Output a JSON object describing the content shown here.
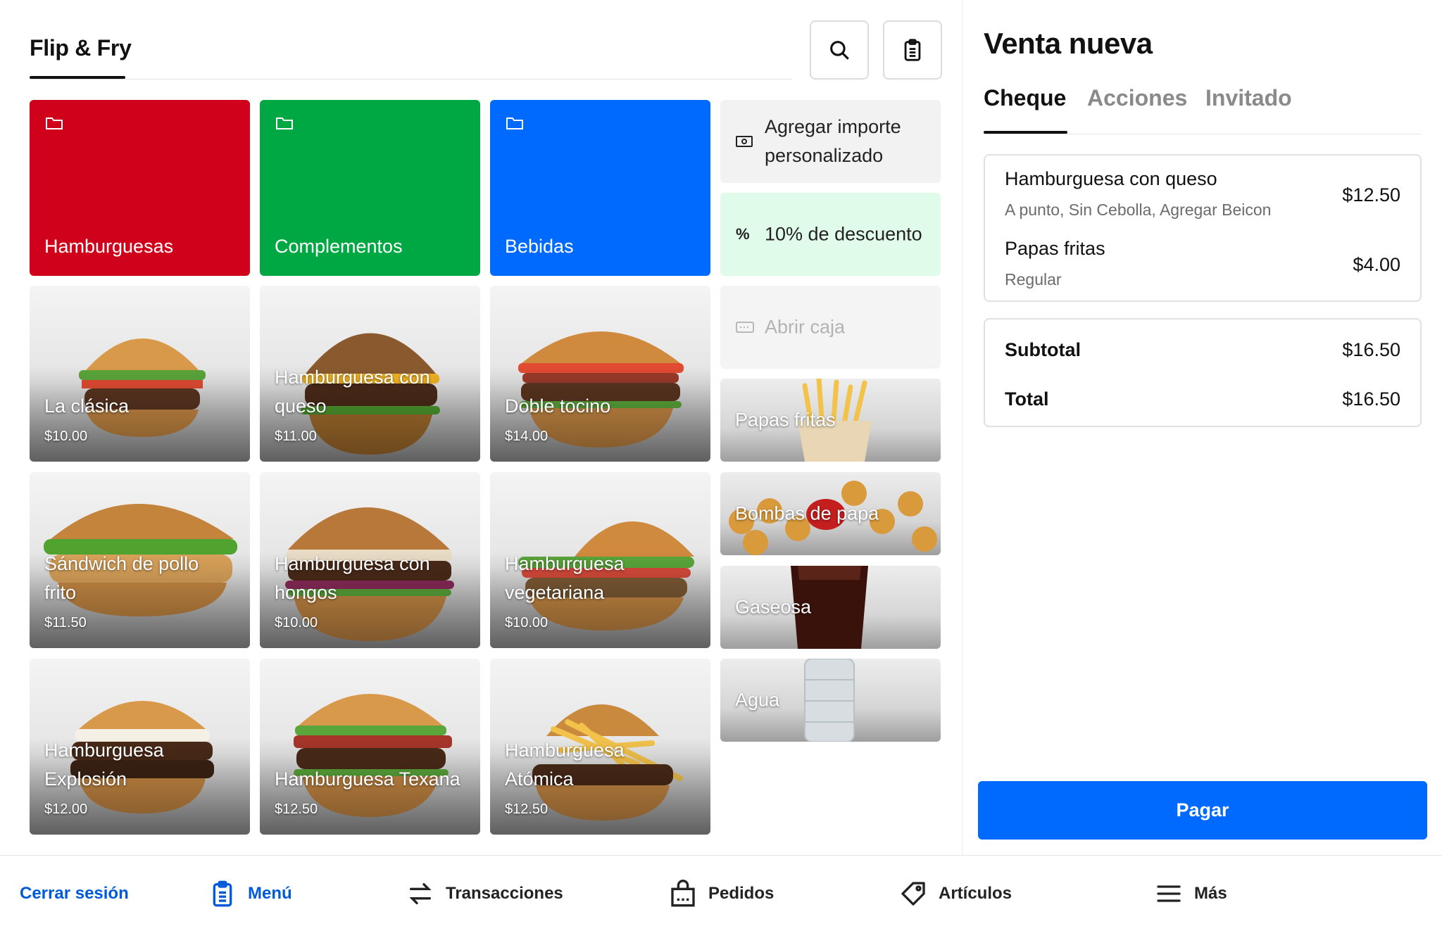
{
  "header": {
    "store_name": "Flip & Fry",
    "search_icon": "search-icon",
    "orders_icon": "clipboard-icon"
  },
  "categories": [
    {
      "label": "Hamburguesas",
      "color": "#d0021b"
    },
    {
      "label": "Complementos",
      "color": "#00a843"
    },
    {
      "label": "Bebidas",
      "color": "#006aff"
    }
  ],
  "actions": {
    "custom_amount": "Agregar importe personalizado",
    "discount": "10% de descuento",
    "discount_symbol": "%",
    "open_drawer": "Abrir caja"
  },
  "items": [
    {
      "name": "La clásica",
      "price": "$10.00"
    },
    {
      "name": "Hamburguesa con queso",
      "price": "$11.00"
    },
    {
      "name": "Doble tocino",
      "price": "$14.00"
    },
    {
      "name": "Sándwich de pollo frito",
      "price": "$11.50"
    },
    {
      "name": "Hamburguesa con hongos",
      "price": "$10.00"
    },
    {
      "name": "Hamburguesa vegetariana",
      "price": "$10.00"
    },
    {
      "name": "Hamburguesa Explosión",
      "price": "$12.00"
    },
    {
      "name": "Hamburguesa Texana",
      "price": "$12.50"
    },
    {
      "name": "Hamburguesa Atómica",
      "price": "$12.50"
    }
  ],
  "side_items": [
    {
      "name": "Papas fritas"
    },
    {
      "name": "Bombas de papa"
    },
    {
      "name": "Gaseosa"
    },
    {
      "name": "Agua"
    }
  ],
  "sale": {
    "title": "Venta nueva",
    "tabs": [
      "Cheque",
      "Acciones",
      "Invitado"
    ],
    "lines": [
      {
        "name": "Hamburguesa con queso",
        "modifiers": "A punto, Sin Cebolla, Agregar Beicon",
        "price": "$12.50"
      },
      {
        "name": "Papas fritas",
        "modifiers": "Regular",
        "price": "$4.00"
      }
    ],
    "subtotal_label": "Subtotal",
    "subtotal": "$16.50",
    "total_label": "Total",
    "total": "$16.50",
    "pay_label": "Pagar",
    "pay_color": "#006aff"
  },
  "nav": {
    "sign_out": "Cerrar sesión",
    "menu": "Menú",
    "transactions": "Transacciones",
    "orders": "Pedidos",
    "items": "Artículos",
    "more": "Más",
    "active_color": "#005ad9"
  }
}
